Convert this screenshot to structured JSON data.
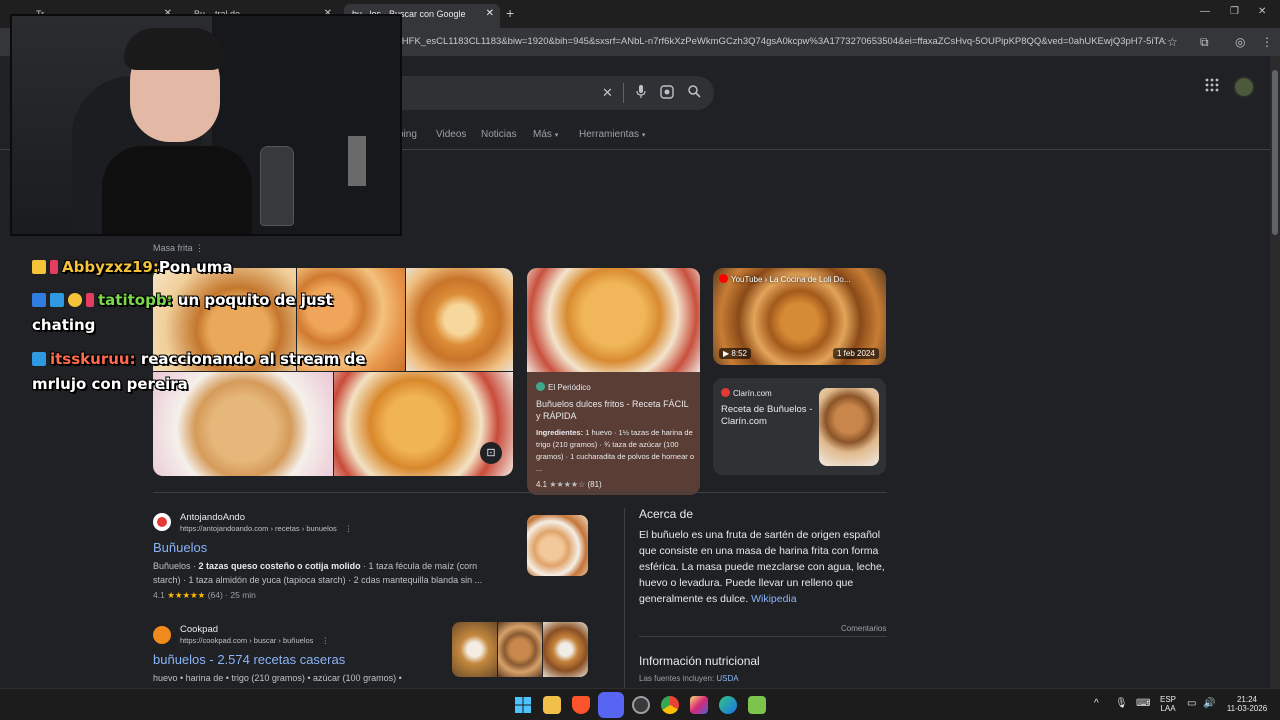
{
  "browser": {
    "tabs": [
      {
        "label": "Tr...",
        "active": false
      },
      {
        "label": "Bu... tral de ...",
        "active": false
      },
      {
        "label": "bu...los - Buscar con Google",
        "active": true
      }
    ],
    "url": "FHFK_esCL1183CL1183&biw=1920&bih=945&sxsrf=ANbL-n7rf6kXzPeWkmGCzh3Q74gsA0kcpw%3A1773270653504&ei=ffaxaZCsHvq-5OUPipKP8QQ&ved=0ahUKEwjQ3pH7-5iTAxV..."
  },
  "google": {
    "nav_tabs": [
      "ping",
      "Videos",
      "Noticias",
      "Más",
      "Herramientas"
    ],
    "masa_frita_label": "Masa frita",
    "cards": {
      "periodico": {
        "source": "El Periódico",
        "title": "Buñuelos dulces fritos - Receta FÁCIL y RÁPIDA",
        "ingredients_label": "Ingredientes:",
        "ingredients": "1 huevo · 1½ tazas de harina de trigo (210 gramos) · ¾ taza de azúcar (100 gramos) · 1 cucharadita de polvos de hornear o ...",
        "rating": "4.1",
        "stars": "★★★★☆",
        "count": "(81)"
      },
      "youtube": {
        "source": "YouTube › La Cocina de Loli Do...",
        "duration": "8:52",
        "date": "1 feb 2024"
      },
      "clarin": {
        "source": "Clarín.com",
        "title": "Receta de Buñuelos - Clarín.com"
      }
    },
    "results": [
      {
        "site": "AntojandoAndo",
        "url": "https://antojandoando.com › recetas › bunuelos",
        "title": "Buñuelos",
        "snippet_pre": "Buñuelos · ",
        "snippet_bold": "2 tazas queso costeño o cotija molido",
        "snippet_post": " · 1 taza fécula de maíz (corn starch) · 1 taza almidón de yuca (tapioca starch) · 2 cdas mantequilla blanda sin ...",
        "rating": "4.1",
        "stars": "★★★★★",
        "count": "(64)",
        "time": "25 min"
      },
      {
        "site": "Cookpad",
        "url": "https://cookpad.com › buscar › buñuelos",
        "title": "buñuelos - 2.574 recetas caseras",
        "snippet": "huevo • harina de • trigo (210 gramos) • azúcar (100 gramos) •"
      }
    ],
    "knowledge": {
      "heading": "Acerca de",
      "body": "El buñuelo es una fruta de sartén de origen español que consiste en una masa de harina frita con forma esférica. La masa puede mezclarse con agua, leche, huevo o levadura. Puede llevar un relleno que generalmente es dulce.",
      "wiki": "Wikipedia",
      "comments": "Comentarios",
      "nutrition_heading": "Información nutricional",
      "sources_label": "Las fuentes incluyen:",
      "sources_value": "USDA"
    }
  },
  "chat": [
    {
      "user": "Abbyzxz19:",
      "message": "Pon uma",
      "user_class": "user-y"
    },
    {
      "user": "tatitopb:",
      "message": "un poquito de just",
      "continuation": "chating",
      "user_class": "user-g"
    },
    {
      "user": "itsskuruu:",
      "message": "reaccionando al stream de",
      "continuation": "mrlujo con pereira",
      "user_class": "user-r"
    }
  ],
  "taskbar": {
    "lang_top": "ESP",
    "lang_bottom": "LAA",
    "time": "21:24",
    "date": "11-03-2026"
  },
  "colors": {
    "page_bg": "#202124",
    "link": "#8ab4f8",
    "card_bg": "#303134"
  }
}
